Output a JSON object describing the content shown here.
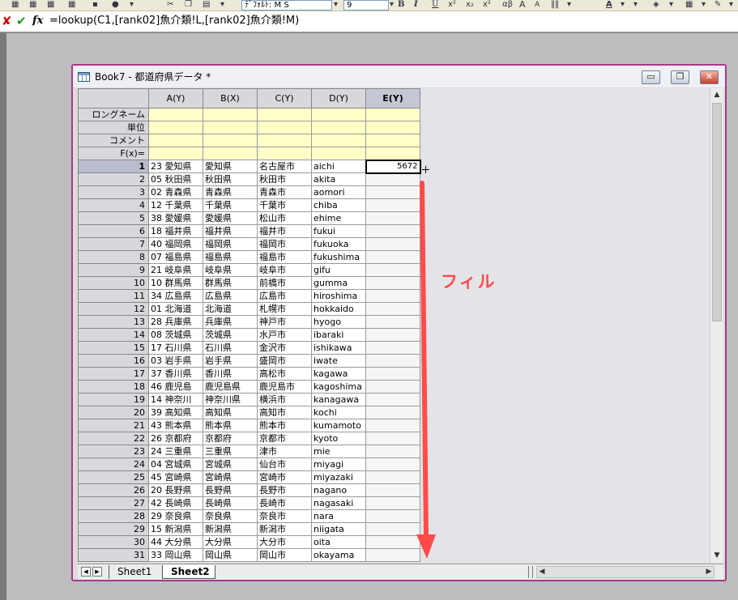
{
  "toolbar": {
    "font_name": "ﾃﾞﾌｫﾙﾄ: M S",
    "font_size": "9",
    "bold_label": "B",
    "italic_label": "I",
    "underline_label": "U",
    "sup_label": "x²",
    "sub_label": "x₂",
    "greek_label": "αβ",
    "grow_font_label": "A",
    "shrink_font_label": "A",
    "font_color_label": "A"
  },
  "formula_bar": {
    "cancel_icon": "x-icon",
    "ok_icon": "check-icon",
    "fx_label": "fx",
    "formula": "=lookup(C1,[rank02]魚介類!L,[rank02]魚介類!M)"
  },
  "workbook": {
    "title": "Book7 - 都道府県データ *",
    "minimize_label": "▭",
    "restore_label": "❐",
    "close_label": "✕",
    "columns": [
      "A(Y)",
      "B(X)",
      "C(Y)",
      "D(Y)",
      "E(Y)"
    ],
    "meta_rows": [
      "ロングネーム",
      "単位",
      "コメント",
      "F(x)="
    ],
    "rows": [
      [
        "1",
        "23 愛知県",
        "愛知県",
        "名古屋市",
        "aichi",
        "5672"
      ],
      [
        "2",
        "05 秋田県",
        "秋田県",
        "秋田市",
        "akita",
        ""
      ],
      [
        "3",
        "02 青森県",
        "青森県",
        "青森市",
        "aomori",
        ""
      ],
      [
        "4",
        "12 千葉県",
        "千葉県",
        "千葉市",
        "chiba",
        ""
      ],
      [
        "5",
        "38 愛媛県",
        "愛媛県",
        "松山市",
        "ehime",
        ""
      ],
      [
        "6",
        "18 福井県",
        "福井県",
        "福井市",
        "fukui",
        ""
      ],
      [
        "7",
        "40 福岡県",
        "福岡県",
        "福岡市",
        "fukuoka",
        ""
      ],
      [
        "8",
        "07 福島県",
        "福島県",
        "福島市",
        "fukushima",
        ""
      ],
      [
        "9",
        "21 岐阜県",
        "岐阜県",
        "岐阜市",
        "gifu",
        ""
      ],
      [
        "10",
        "10 群馬県",
        "群馬県",
        "前橋市",
        "gumma",
        ""
      ],
      [
        "11",
        "34 広島県",
        "広島県",
        "広島市",
        "hiroshima",
        ""
      ],
      [
        "12",
        "01 北海道",
        "北海道",
        "札幌市",
        "hokkaido",
        ""
      ],
      [
        "13",
        "28 兵庫県",
        "兵庫県",
        "神戸市",
        "hyogo",
        ""
      ],
      [
        "14",
        "08 茨城県",
        "茨城県",
        "水戸市",
        "ibaraki",
        ""
      ],
      [
        "15",
        "17 石川県",
        "石川県",
        "金沢市",
        "ishikawa",
        ""
      ],
      [
        "16",
        "03 岩手県",
        "岩手県",
        "盛岡市",
        "iwate",
        ""
      ],
      [
        "17",
        "37 香川県",
        "香川県",
        "高松市",
        "kagawa",
        ""
      ],
      [
        "18",
        "46 鹿児島",
        "鹿児島県",
        "鹿児島市",
        "kagoshima",
        ""
      ],
      [
        "19",
        "14 神奈川",
        "神奈川県",
        "横浜市",
        "kanagawa",
        ""
      ],
      [
        "20",
        "39 高知県",
        "高知県",
        "高知市",
        "kochi",
        ""
      ],
      [
        "21",
        "43 熊本県",
        "熊本県",
        "熊本市",
        "kumamoto",
        ""
      ],
      [
        "22",
        "26 京都府",
        "京都府",
        "京都市",
        "kyoto",
        ""
      ],
      [
        "23",
        "24 三重県",
        "三重県",
        "津市",
        "mie",
        ""
      ],
      [
        "24",
        "04 宮城県",
        "宮城県",
        "仙台市",
        "miyagi",
        ""
      ],
      [
        "25",
        "45 宮崎県",
        "宮崎県",
        "宮崎市",
        "miyazaki",
        ""
      ],
      [
        "26",
        "20 長野県",
        "長野県",
        "長野市",
        "nagano",
        ""
      ],
      [
        "27",
        "42 長崎県",
        "長崎県",
        "長崎市",
        "nagasaki",
        ""
      ],
      [
        "28",
        "29 奈良県",
        "奈良県",
        "奈良市",
        "nara",
        ""
      ],
      [
        "29",
        "15 新潟県",
        "新潟県",
        "新潟市",
        "niigata",
        ""
      ],
      [
        "30",
        "44 大分県",
        "大分県",
        "大分市",
        "oita",
        ""
      ],
      [
        "31",
        "33 岡山県",
        "岡山県",
        "岡山市",
        "okayama",
        ""
      ]
    ],
    "sheets": [
      "Sheet1",
      "Sheet2"
    ]
  },
  "annotation": {
    "label": "フィル",
    "color": "#ff4a4a"
  }
}
